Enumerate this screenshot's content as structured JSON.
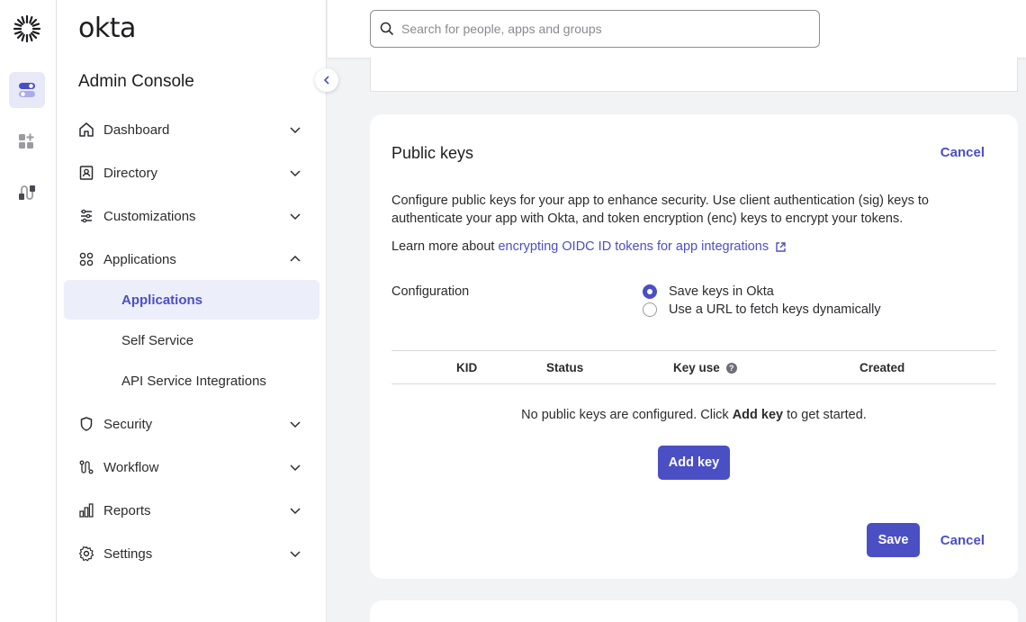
{
  "brand": {
    "wordmark": "okta",
    "accent": "#4b4fc4"
  },
  "rail": {
    "items": [
      {
        "icon": "toggle-icon",
        "active": true
      },
      {
        "icon": "add-apps-icon",
        "active": false
      },
      {
        "icon": "workflow-icon",
        "active": false
      }
    ]
  },
  "sidenav": {
    "console_title": "Admin Console",
    "items": [
      {
        "label": "Dashboard",
        "icon": "home-icon",
        "expanded": false
      },
      {
        "label": "Directory",
        "icon": "directory-icon",
        "expanded": false
      },
      {
        "label": "Customizations",
        "icon": "customizations-icon",
        "expanded": false
      },
      {
        "label": "Applications",
        "icon": "applications-icon",
        "expanded": true
      },
      {
        "label": "Security",
        "icon": "shield-icon",
        "expanded": false
      },
      {
        "label": "Workflow",
        "icon": "workflow-icon",
        "expanded": false
      },
      {
        "label": "Reports",
        "icon": "reports-icon",
        "expanded": false
      },
      {
        "label": "Settings",
        "icon": "gear-icon",
        "expanded": false
      }
    ],
    "sub_items": [
      {
        "label": "Applications",
        "active": true
      },
      {
        "label": "Self Service",
        "active": false
      },
      {
        "label": "API Service Integrations",
        "active": false
      }
    ]
  },
  "search": {
    "placeholder": "Search for people, apps and groups",
    "value": ""
  },
  "public_keys": {
    "title": "Public keys",
    "cancel_label": "Cancel",
    "description": "Configure public keys for your app to enhance security. Use client authentication (sig) keys to authenticate your app with Okta, and token encryption (enc) keys to encrypt your tokens.",
    "learn_prefix": "Learn more about",
    "learn_link": "encrypting OIDC ID tokens for app integrations",
    "configuration_label": "Configuration",
    "options": [
      {
        "label": "Save keys in Okta",
        "selected": true
      },
      {
        "label": "Use a URL to fetch keys dynamically",
        "selected": false
      }
    ],
    "table_headers": [
      "KID",
      "Status",
      "Key use",
      "Created"
    ],
    "empty_prefix": "No public keys are configured. Click",
    "empty_bold": "Add key",
    "empty_suffix": "to get started.",
    "add_key_label": "Add key",
    "save_label": "Save",
    "cancel_bottom_label": "Cancel"
  }
}
